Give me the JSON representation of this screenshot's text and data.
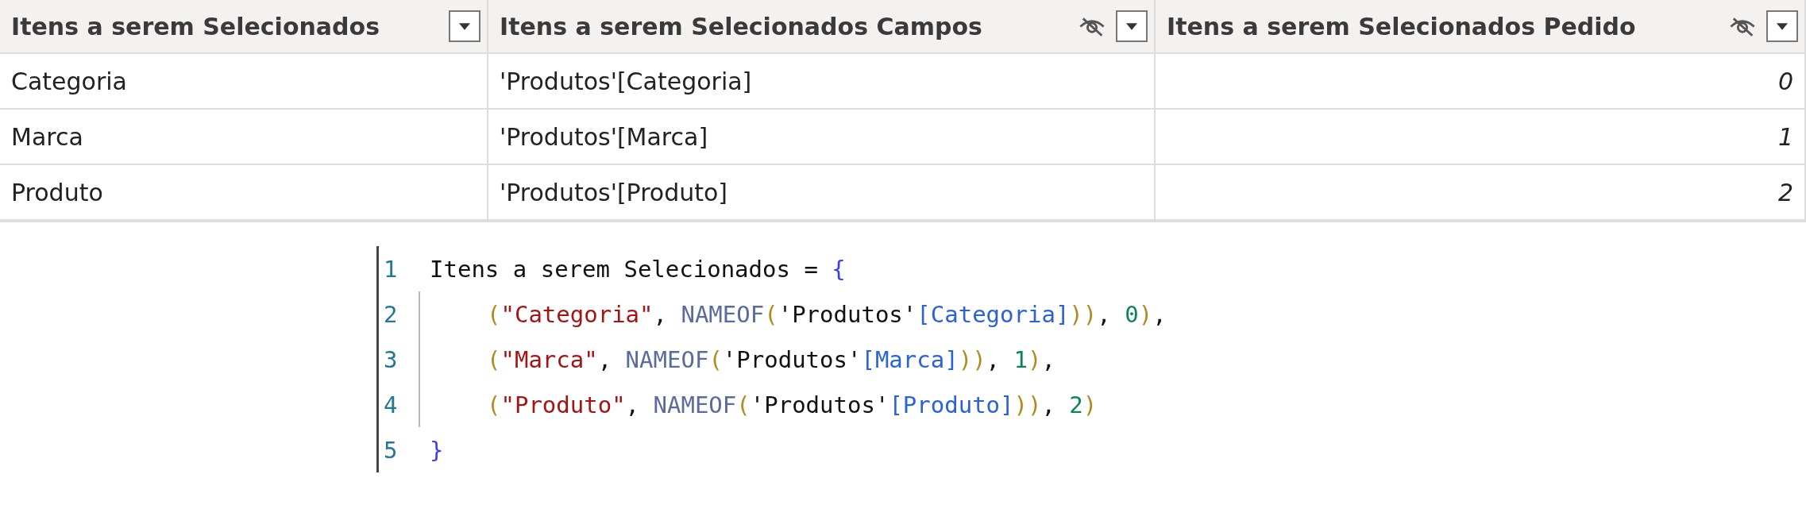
{
  "table": {
    "columns": [
      {
        "label": "Itens a serem Selecionados",
        "hidden": false,
        "kind": "text"
      },
      {
        "label": "Itens a serem Selecionados Campos",
        "hidden": true,
        "kind": "text"
      },
      {
        "label": "Itens a serem Selecionados Pedido",
        "hidden": true,
        "kind": "number"
      }
    ],
    "rows": [
      [
        "Categoria",
        "'Produtos'[Categoria]",
        "0"
      ],
      [
        "Marca",
        "'Produtos'[Marca]",
        "1"
      ],
      [
        "Produto",
        "'Produtos'[Produto]",
        "2"
      ]
    ]
  },
  "code": {
    "lines": [
      {
        "number": "1",
        "indented": false,
        "tokens": [
          {
            "kind": "plain",
            "text": "Itens a serem Selecionados = "
          },
          {
            "kind": "brace",
            "text": "{"
          }
        ]
      },
      {
        "number": "2",
        "indented": true,
        "tokens": [
          {
            "kind": "paren",
            "text": "("
          },
          {
            "kind": "string",
            "text": "\"Categoria\""
          },
          {
            "kind": "plain",
            "text": ", "
          },
          {
            "kind": "func",
            "text": "NAMEOF"
          },
          {
            "kind": "paren",
            "text": "("
          },
          {
            "kind": "plain",
            "text": "'Produtos'"
          },
          {
            "kind": "column",
            "text": "[Categoria]"
          },
          {
            "kind": "paren",
            "text": "))"
          },
          {
            "kind": "plain",
            "text": ", "
          },
          {
            "kind": "number",
            "text": "0"
          },
          {
            "kind": "paren",
            "text": ")"
          },
          {
            "kind": "plain",
            "text": ","
          }
        ]
      },
      {
        "number": "3",
        "indented": true,
        "tokens": [
          {
            "kind": "paren",
            "text": "("
          },
          {
            "kind": "string",
            "text": "\"Marca\""
          },
          {
            "kind": "plain",
            "text": ", "
          },
          {
            "kind": "func",
            "text": "NAMEOF"
          },
          {
            "kind": "paren",
            "text": "("
          },
          {
            "kind": "plain",
            "text": "'Produtos'"
          },
          {
            "kind": "column",
            "text": "[Marca]"
          },
          {
            "kind": "paren",
            "text": "))"
          },
          {
            "kind": "plain",
            "text": ", "
          },
          {
            "kind": "number",
            "text": "1"
          },
          {
            "kind": "paren",
            "text": ")"
          },
          {
            "kind": "plain",
            "text": ","
          }
        ]
      },
      {
        "number": "4",
        "indented": true,
        "tokens": [
          {
            "kind": "paren",
            "text": "("
          },
          {
            "kind": "string",
            "text": "\"Produto\""
          },
          {
            "kind": "plain",
            "text": ", "
          },
          {
            "kind": "func",
            "text": "NAMEOF"
          },
          {
            "kind": "paren",
            "text": "("
          },
          {
            "kind": "plain",
            "text": "'Produtos'"
          },
          {
            "kind": "column",
            "text": "[Produto]"
          },
          {
            "kind": "paren",
            "text": "))"
          },
          {
            "kind": "plain",
            "text": ", "
          },
          {
            "kind": "number",
            "text": "2"
          },
          {
            "kind": "paren",
            "text": ")"
          }
        ]
      },
      {
        "number": "5",
        "indented": false,
        "tokens": [
          {
            "kind": "brace",
            "text": "}"
          }
        ]
      }
    ]
  }
}
